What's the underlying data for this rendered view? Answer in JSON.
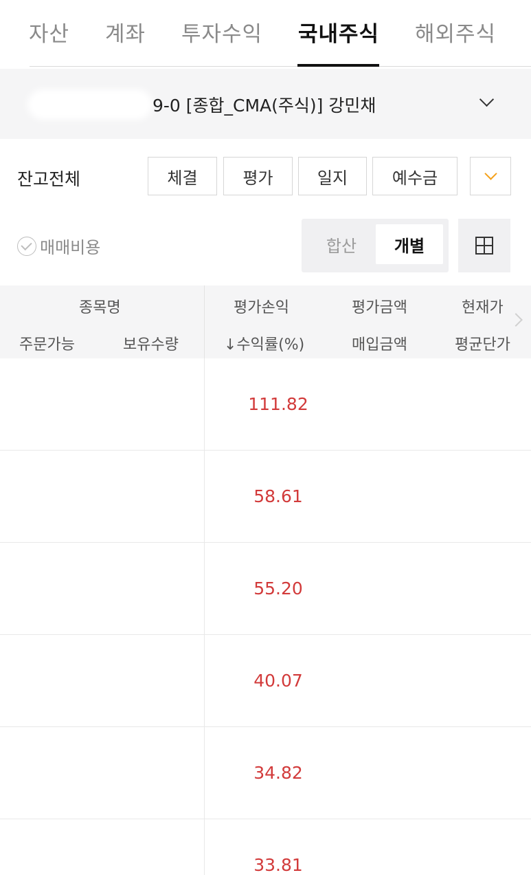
{
  "tabs": [
    {
      "label": "자산",
      "active": false
    },
    {
      "label": "계좌",
      "active": false
    },
    {
      "label": "투자수익",
      "active": false
    },
    {
      "label": "국내주식",
      "active": true
    },
    {
      "label": "해외주식",
      "active": false
    }
  ],
  "account": {
    "label": "9-0 [종합_CMA(주식)] 강민채"
  },
  "filters": {
    "balance_select": "잔고전체",
    "buttons": [
      "체결",
      "평가",
      "일지",
      "예수금"
    ]
  },
  "options": {
    "fee_label": "매매비용",
    "segment": [
      "합산",
      "개별"
    ],
    "segment_selected": "개별"
  },
  "table": {
    "headers": {
      "name": "종목명",
      "orderable": "주문가능",
      "holding": "보유수량",
      "profit": "평가손익",
      "return_rate": "↓수익률(%)",
      "eval_amount": "평가금액",
      "buy_amount": "매입금액",
      "current_price": "현재가",
      "avg_price": "평균단가"
    },
    "rows": [
      {
        "return_rate": "111.82"
      },
      {
        "return_rate": "58.61"
      },
      {
        "return_rate": "55.20"
      },
      {
        "return_rate": "40.07"
      },
      {
        "return_rate": "34.82"
      },
      {
        "return_rate": "33.81"
      }
    ]
  },
  "colors": {
    "positive": "#d23a3a",
    "accent": "#f5a11a",
    "active_tab": "#111111"
  }
}
